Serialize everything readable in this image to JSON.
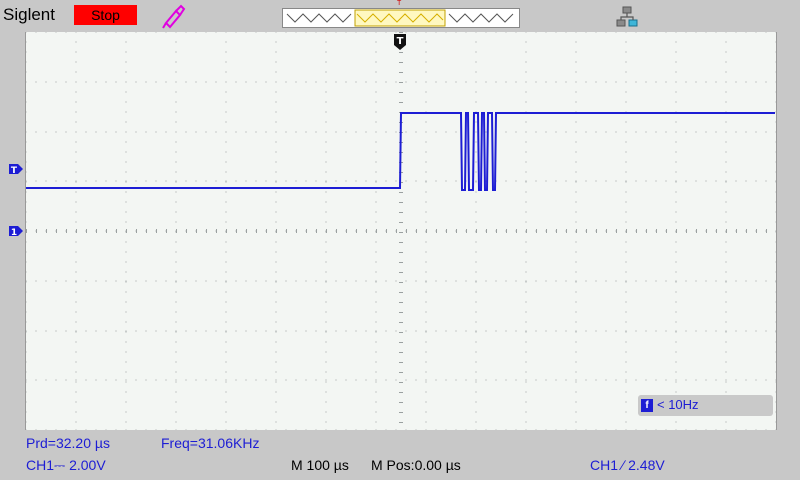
{
  "header": {
    "brand": "Siglent",
    "run_state": "Stop",
    "trigger_tag": "T",
    "icons": [
      "probe-icon",
      "network-icon"
    ]
  },
  "colors": {
    "trace": "#1d1dd4",
    "stop": "#ff0000",
    "grid": "#9aa0a0",
    "screen_bg": "#f3f6f3"
  },
  "markers": {
    "trigger": "T",
    "ch1_level": "T",
    "ch1_ground": "1"
  },
  "freq_counter": {
    "icon": "f",
    "text": "< 10Hz"
  },
  "measurements": {
    "period": "Prd=32.20 µs",
    "frequency": "Freq=31.06KHz"
  },
  "settings": {
    "ch1_scale": "CH1⎓ 2.00V",
    "timebase": "M 100 µs",
    "position": "M Pos:0.00 µs",
    "trigger": "CH1 ∕ 2.48V"
  }
}
